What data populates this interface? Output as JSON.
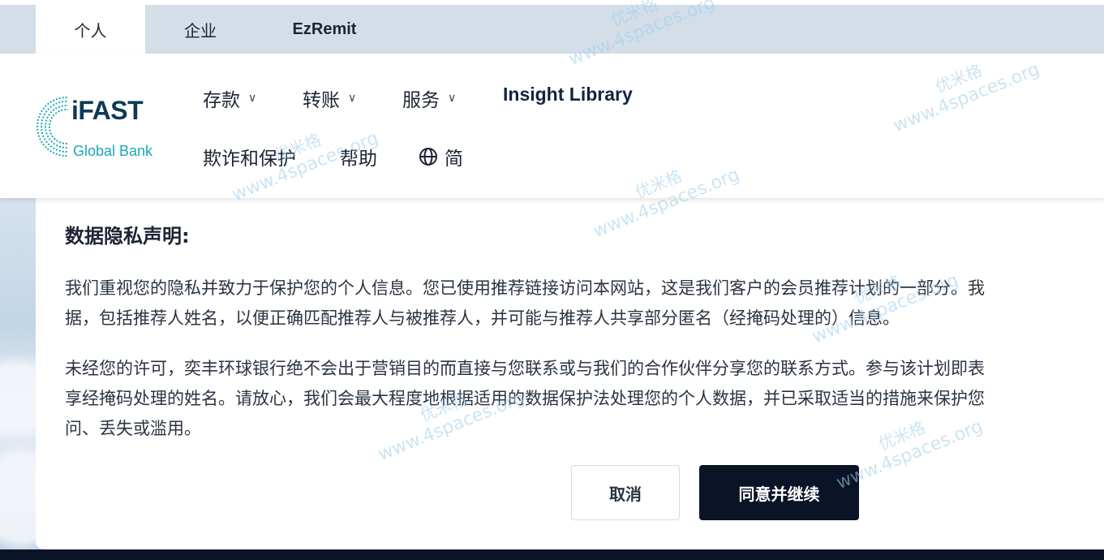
{
  "tabs": [
    {
      "label": "个人",
      "active": true
    },
    {
      "label": "企业",
      "active": false
    },
    {
      "label": "EzRemit",
      "active": false
    }
  ],
  "logo": {
    "brand": "iFAST",
    "sub": "Global Bank",
    "color_primary": "#0e3a55",
    "color_accent": "#1aa8b8"
  },
  "nav": {
    "row1": [
      {
        "label": "存款",
        "icon": "chevron-down-icon"
      },
      {
        "label": "转账",
        "icon": "chevron-down-icon"
      },
      {
        "label": "服务",
        "icon": "chevron-down-icon"
      },
      {
        "label": "Insight Library"
      }
    ],
    "row2": [
      {
        "label": "欺诈和保护"
      },
      {
        "label": "帮助"
      },
      {
        "label": "简",
        "icon": "globe-icon"
      }
    ]
  },
  "modal": {
    "title": "数据隐私声明:",
    "paragraph1": [
      "我们重视您的隐私并致力于保护您的个人信息。您已使用推荐链接访问本网站，这是我们客户的会员推荐计划的一部分。我",
      "据，包括推荐人姓名，以便正确匹配推荐人与被推荐人，并可能与推荐人共享部分匿名（经掩码处理的）信息。"
    ],
    "paragraph2": [
      "未经您的许可，奕丰环球银行绝不会出于营销目的而直接与您联系或与我们的合作伙伴分享您的联系方式。参与该计划即表",
      "享经掩码处理的姓名。请放心，我们会最大程度地根据适用的数据保护法处理您的个人数据，并已采取适当的措施来保护您",
      "问、丢失或滥用。"
    ],
    "cancel_label": "取消",
    "agree_label": "同意并继续"
  },
  "watermark": {
    "line1": "优米格",
    "line2": "www.4spaces.org"
  }
}
